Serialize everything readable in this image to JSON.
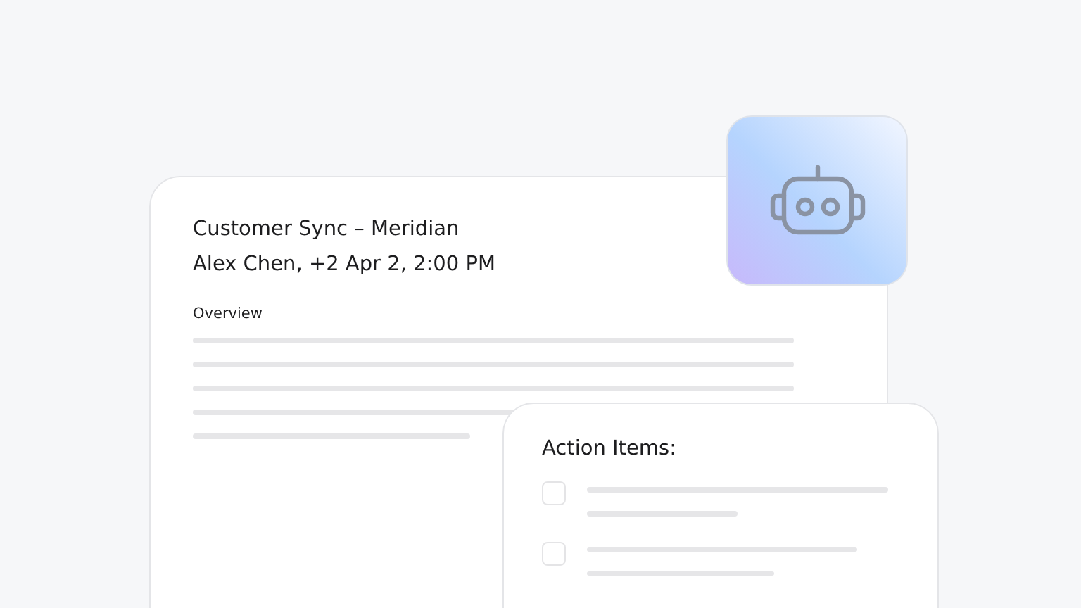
{
  "meeting_card": {
    "title": "Customer Sync – Meridian",
    "subtitle": "Alex Chen, +2  Apr 2, 2:00 PM",
    "section_label": "Overview"
  },
  "action_items": {
    "title": "Action Items:",
    "items": [
      {
        "checked": false
      },
      {
        "checked": false
      }
    ]
  }
}
